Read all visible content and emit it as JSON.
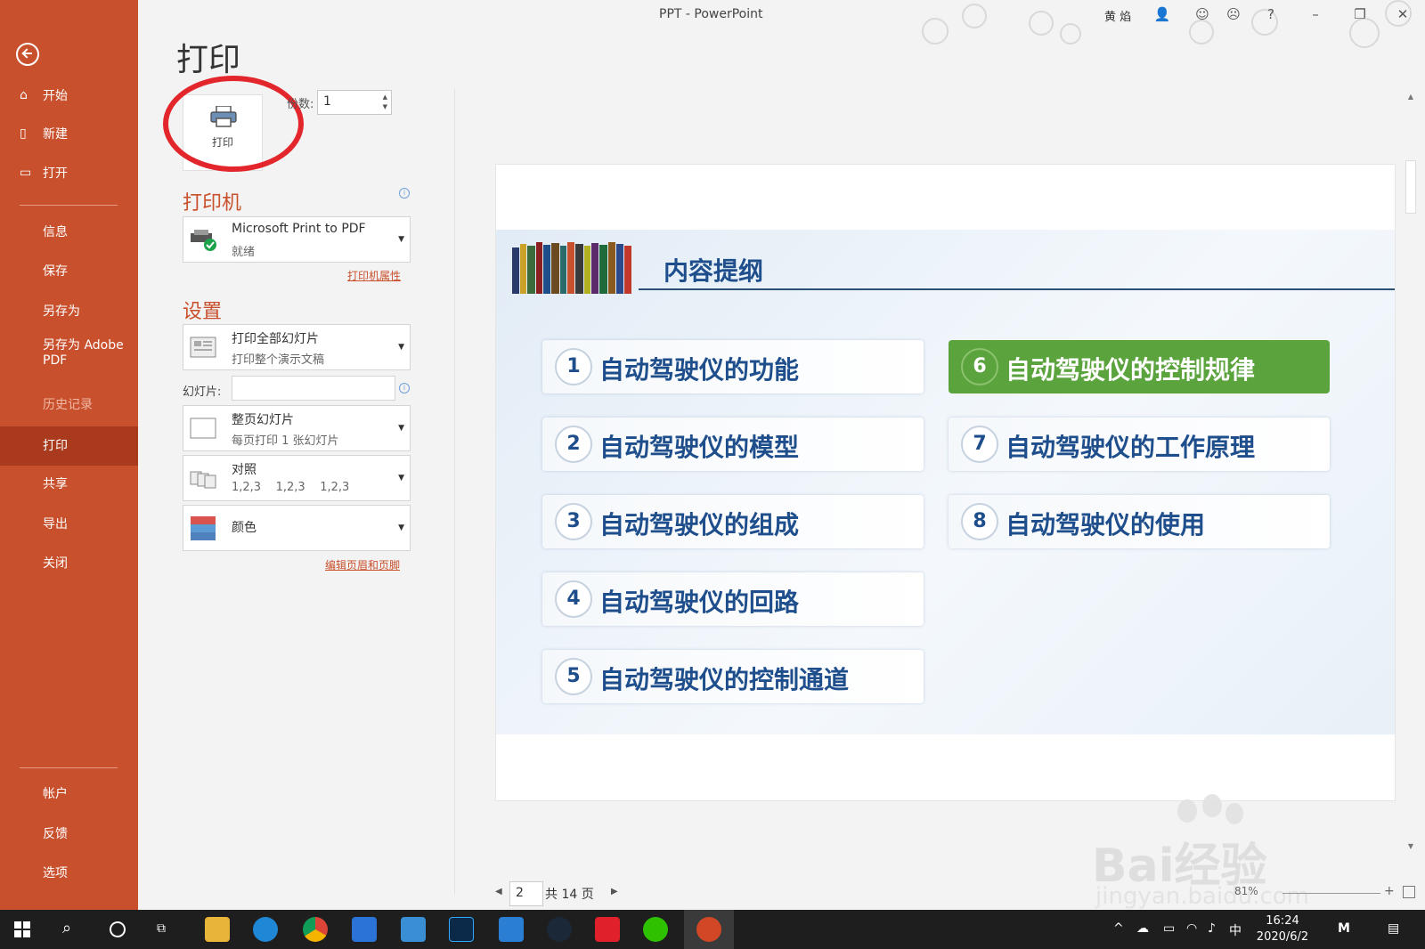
{
  "window": {
    "title": "PPT  -  PowerPoint",
    "user": "黄 焰"
  },
  "nav": {
    "items": [
      {
        "label": "开始",
        "icon": "home-icon"
      },
      {
        "label": "新建",
        "icon": "new-file-icon"
      },
      {
        "label": "打开",
        "icon": "open-folder-icon"
      },
      {
        "label": "信息"
      },
      {
        "label": "保存"
      },
      {
        "label": "另存为"
      },
      {
        "label": "另存为 Adobe PDF"
      },
      {
        "label": "历史记录"
      },
      {
        "label": "打印",
        "active": true
      },
      {
        "label": "共享"
      },
      {
        "label": "导出"
      },
      {
        "label": "关闭"
      }
    ],
    "bottom": [
      {
        "label": "帐户"
      },
      {
        "label": "反馈"
      },
      {
        "label": "选项"
      }
    ]
  },
  "print": {
    "title": "打印",
    "button_label": "打印",
    "copies_label": "份数:",
    "copies_value": "1",
    "printer_heading": "打印机",
    "printer_name": "Microsoft Print to PDF",
    "printer_status": "就绪",
    "printer_props_link": "打印机属性",
    "settings_heading": "设置",
    "range_main": "打印全部幻灯片",
    "range_sub": "打印整个演示文稿",
    "slides_label": "幻灯片:",
    "slides_value": "",
    "layout_main": "整页幻灯片",
    "layout_sub": "每页打印 1 张幻灯片",
    "collate_main": "对照",
    "collate_sub": "1,2,3    1,2,3    1,2,3",
    "color_main": "颜色",
    "header_footer_link": "编辑页眉和页脚"
  },
  "preview": {
    "slide_title": "内容提纲",
    "items": [
      {
        "num": "1",
        "text": "自动驾驶仪的功能"
      },
      {
        "num": "2",
        "text": "自动驾驶仪的模型"
      },
      {
        "num": "3",
        "text": "自动驾驶仪的组成"
      },
      {
        "num": "4",
        "text": "自动驾驶仪的回路"
      },
      {
        "num": "5",
        "text": "自动驾驶仪的控制通道"
      },
      {
        "num": "6",
        "text": "自动驾驶仪的控制规律",
        "highlight": true
      },
      {
        "num": "7",
        "text": "自动驾驶仪的工作原理"
      },
      {
        "num": "8",
        "text": "自动驾驶仪的使用"
      }
    ],
    "highlight_color": "#5ba33d"
  },
  "pager": {
    "current": "2",
    "total": "共 14 页"
  },
  "zoom": {
    "value": "81%"
  },
  "watermark": {
    "brand": "Bai经验",
    "url": "jingyan.baidu.com"
  },
  "taskbar": {
    "apps": [
      "start-icon",
      "search-icon",
      "cortana-icon",
      "task-view-icon",
      "file-explorer-icon",
      "edge-icon",
      "chrome-icon",
      "store-icon",
      "mail-icon",
      "photoshop-icon",
      "browser-icon",
      "steam-icon",
      "netease-music-icon",
      "wechat-icon",
      "powerpoint-icon"
    ],
    "ime": "中",
    "time": "16:24",
    "date": "2020/6/2"
  },
  "colors": {
    "nav_bg": "#c9502d",
    "nav_active": "#a93a1d",
    "accent": "#c9502d",
    "slide_text": "#1f4e8c"
  }
}
